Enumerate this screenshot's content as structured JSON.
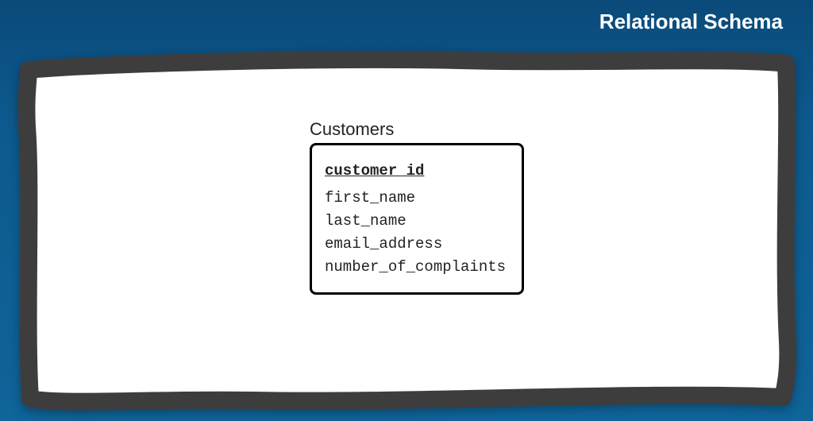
{
  "title": "Relational Schema",
  "table": {
    "name": "Customers",
    "primary_key": "customer_id",
    "fields": [
      "first_name",
      "last_name",
      "email_address",
      "number_of_complaints"
    ]
  }
}
